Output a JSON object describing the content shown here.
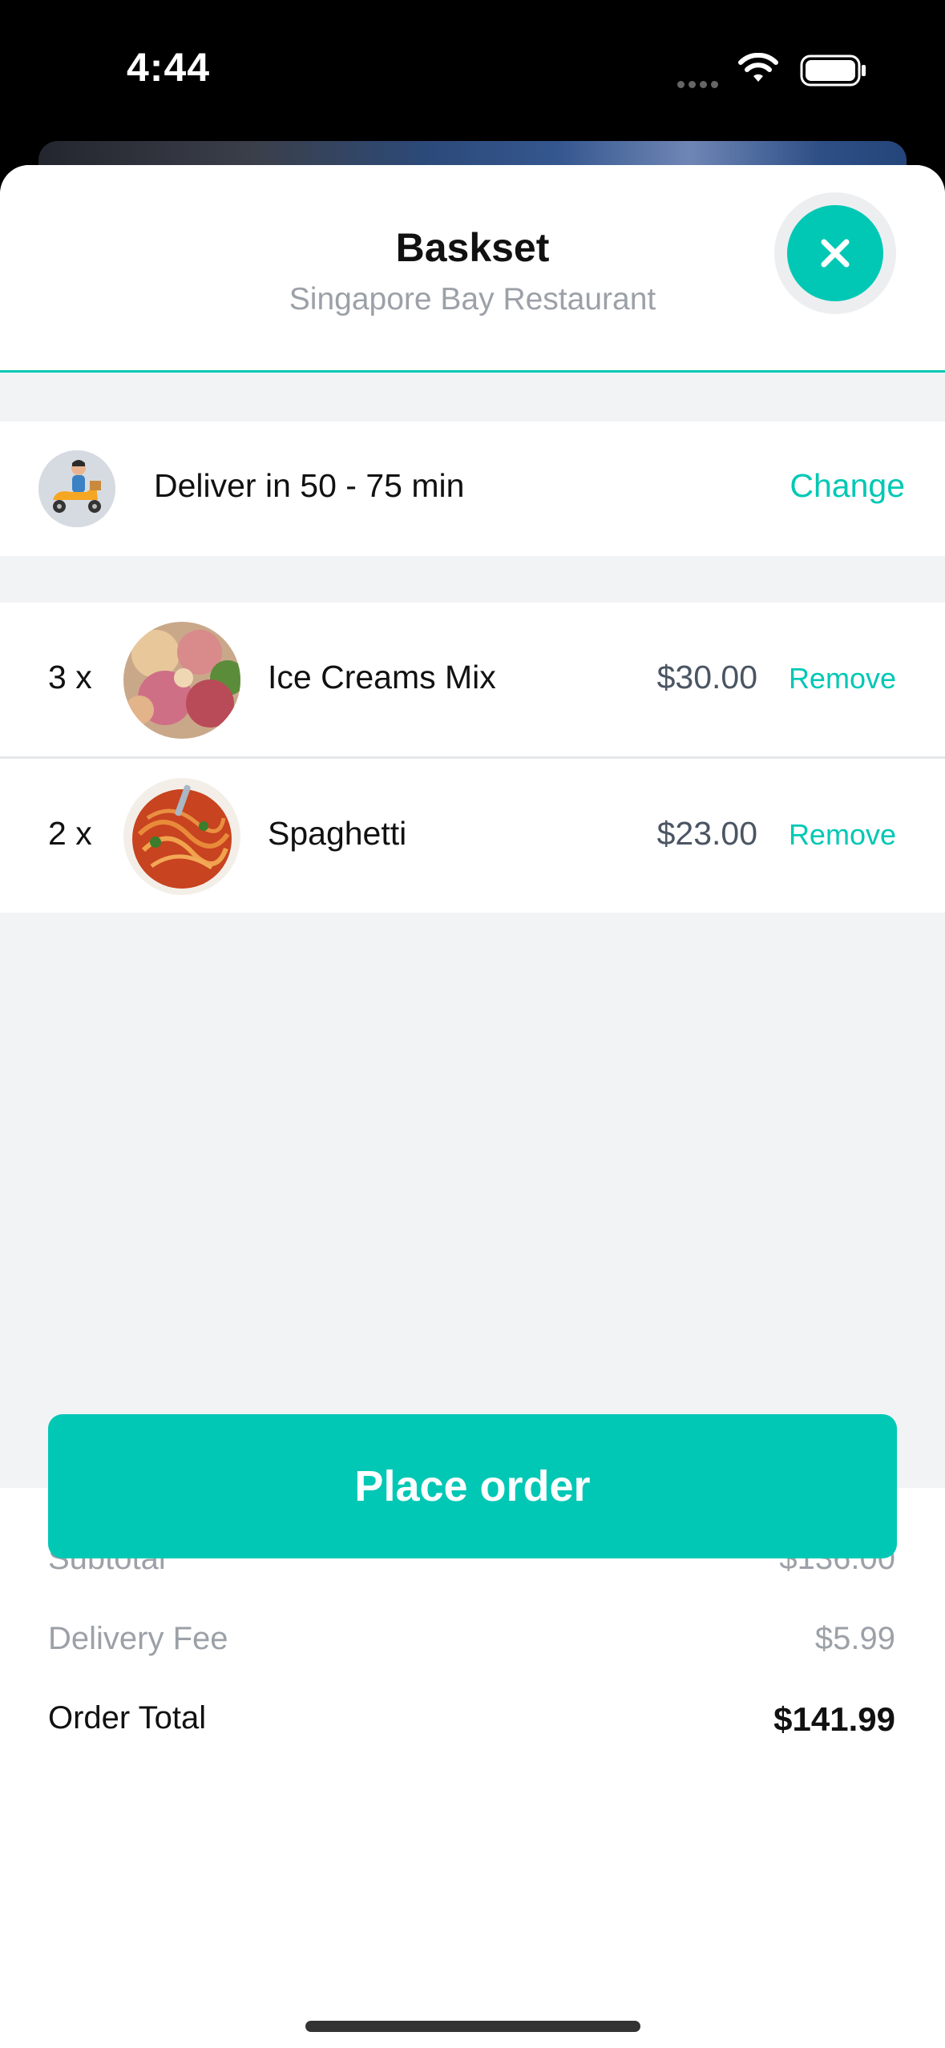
{
  "status_bar": {
    "time": "4:44"
  },
  "header": {
    "title": "Baskset",
    "subtitle": "Singapore Bay Restaurant",
    "close_icon": "close-icon"
  },
  "delivery": {
    "text": "Deliver in 50 - 75 min",
    "change_label": "Change",
    "icon": "delivery-scooter-icon"
  },
  "items": [
    {
      "qty": "3 x",
      "name": "Ice Creams Mix",
      "price": "$30.00",
      "remove_label": "Remove",
      "image": "ice-cream-photo"
    },
    {
      "qty": "2 x",
      "name": "Spaghetti",
      "price": "$23.00",
      "remove_label": "Remove",
      "image": "spaghetti-photo"
    }
  ],
  "summary": {
    "subtotal_label": "Subtotal",
    "subtotal_value": "$136.00",
    "delivery_fee_label": "Delivery Fee",
    "delivery_fee_value": "$5.99",
    "total_label": "Order Total",
    "total_value": "$141.99"
  },
  "actions": {
    "place_order_label": "Place order"
  },
  "colors": {
    "accent": "#00c8b5",
    "muted_text": "#9ca1a8",
    "background": "#f2f3f5"
  }
}
